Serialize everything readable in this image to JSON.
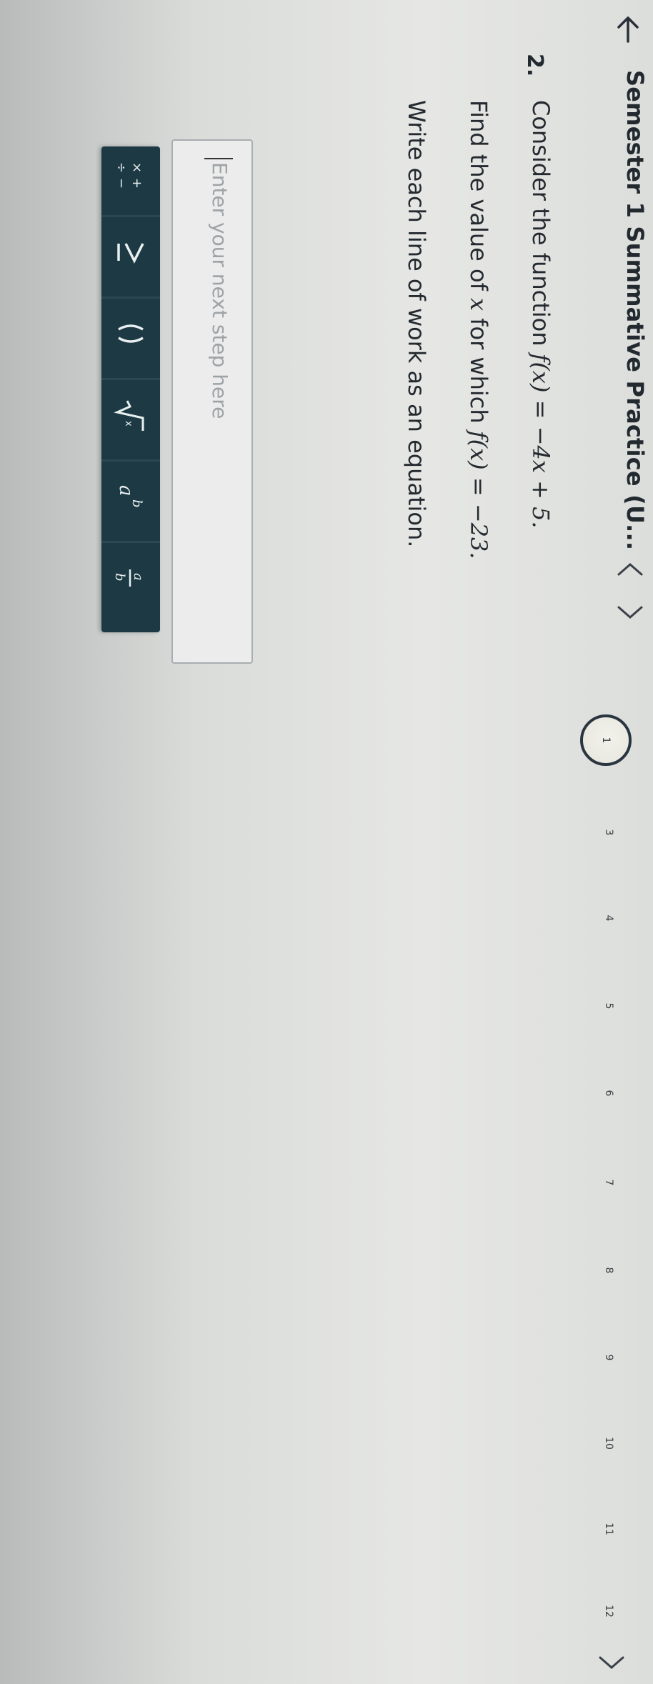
{
  "header": {
    "title": "Semester 1 Summative Practice (U...",
    "back_icon": "arrow-left-icon",
    "prev_icon": "chevron-left-icon",
    "next_icon": "chevron-right-icon",
    "pages": [
      "1",
      "3",
      "4",
      "5",
      "6",
      "7",
      "8",
      "9",
      "10",
      "11",
      "12"
    ],
    "current_page": "1"
  },
  "question": {
    "number": "2.",
    "line1_prefix": "Consider the function ",
    "line1_math": "f(x) = −4x + 5.",
    "line2_prefix": "Find the value of ",
    "line2_var": "x",
    "line2_mid": " for which ",
    "line2_math": "f(x) = −23.",
    "line3": "Write each line of work as an equation."
  },
  "answer": {
    "placeholder": "Enter your next step here"
  },
  "toolbar": {
    "buttons": [
      {
        "icon": "operations-icon",
        "label": "×÷+−"
      },
      {
        "icon": "inequality-icon",
        "label": "≥"
      },
      {
        "icon": "parentheses-icon",
        "label": "( )"
      },
      {
        "icon": "radical-icon",
        "label": "√"
      },
      {
        "icon": "exponent-icon",
        "label": "aᵇ"
      },
      {
        "icon": "fraction-icon",
        "label": "a/b"
      }
    ]
  },
  "colors": {
    "toolbar_bg": "#1d3a44",
    "current_page_ring": "#2a3540",
    "current_page_fill": "#b5d99a"
  }
}
